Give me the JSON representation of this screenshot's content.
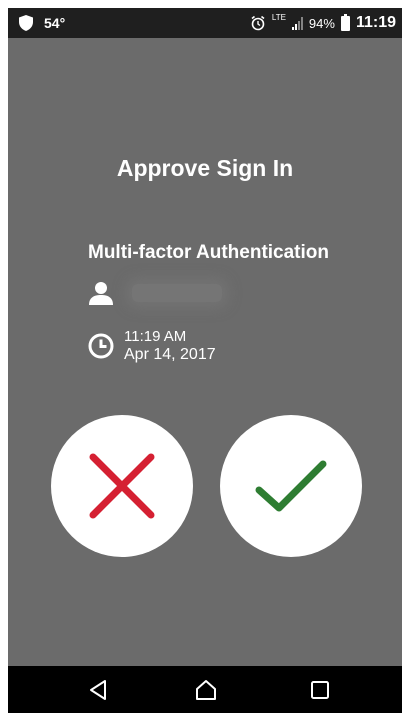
{
  "status_bar": {
    "temperature": "54°",
    "network": "LTE",
    "battery_percent": "94%",
    "time": "11:19",
    "icons": [
      "shield-icon",
      "alarm-icon",
      "signal-icon",
      "battery-icon"
    ]
  },
  "screen": {
    "title": "Approve Sign In",
    "subtitle": "Multi-factor Authentication",
    "time": "11:19 AM",
    "date": "Apr 14, 2017"
  },
  "actions": {
    "deny_icon": "close-icon",
    "approve_icon": "checkmark-icon",
    "deny_color": "#d52032",
    "approve_color": "#2e7d32"
  },
  "nav_bar": {
    "icons": [
      "back-icon",
      "home-icon",
      "recent-apps-icon"
    ]
  },
  "colors": {
    "background": "#6b6b6b",
    "status_bar": "#1f1f1f",
    "nav_bar": "#000000"
  }
}
